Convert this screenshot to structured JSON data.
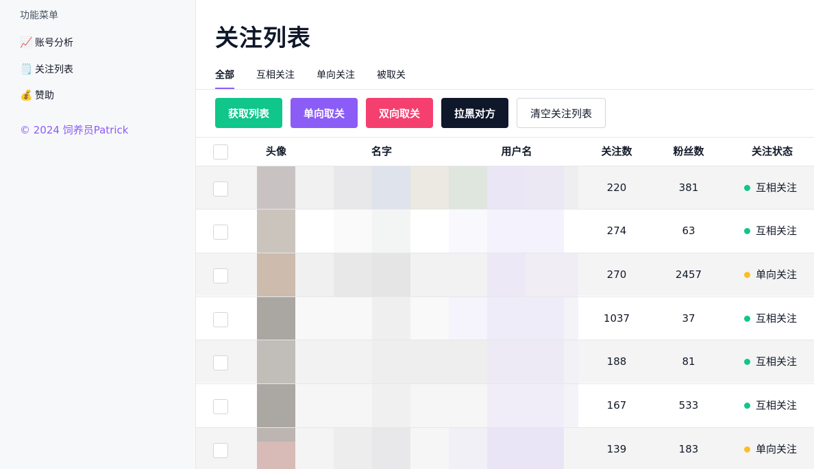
{
  "sidebar": {
    "heading": "功能菜单",
    "items": [
      {
        "icon": "📈",
        "icon_name": "chart-increasing-icon",
        "label": "账号分析"
      },
      {
        "icon": "🗒️",
        "icon_name": "notepad-icon",
        "label": "关注列表"
      },
      {
        "icon": "💰",
        "icon_name": "money-bag-icon",
        "label": "赞助"
      }
    ],
    "copyright": "© 2024 饲养员Patrick"
  },
  "main": {
    "title": "关注列表",
    "tabs": [
      {
        "label": "全部",
        "active": true
      },
      {
        "label": "互相关注",
        "active": false
      },
      {
        "label": "单向关注",
        "active": false
      },
      {
        "label": "被取关",
        "active": false
      }
    ],
    "buttons": {
      "fetch": "获取列表",
      "unfollow_oneway": "单向取关",
      "unfollow_twoway": "双向取关",
      "block": "拉黑对方",
      "clear": "清空关注列表"
    },
    "table": {
      "headers": {
        "avatar": "头像",
        "name": "名字",
        "username": "用户名",
        "following": "关注数",
        "followers": "粉丝数",
        "status": "关注状态"
      },
      "rows": [
        {
          "following": "220",
          "followers": "381",
          "status": "互相关注",
          "status_color": "#10c68a"
        },
        {
          "following": "274",
          "followers": "63",
          "status": "互相关注",
          "status_color": "#10c68a"
        },
        {
          "following": "270",
          "followers": "2457",
          "status": "单向关注",
          "status_color": "#fbbf24"
        },
        {
          "following": "1037",
          "followers": "37",
          "status": "互相关注",
          "status_color": "#10c68a"
        },
        {
          "following": "188",
          "followers": "81",
          "status": "互相关注",
          "status_color": "#10c68a"
        },
        {
          "following": "167",
          "followers": "533",
          "status": "互相关注",
          "status_color": "#10c68a"
        },
        {
          "following": "139",
          "followers": "183",
          "status": "单向关注",
          "status_color": "#fbbf24"
        }
      ]
    }
  },
  "colors": {
    "accent": "#8b5cf6",
    "success": "#10c68a",
    "danger": "#f43f6f",
    "dark": "#0f172a",
    "warning": "#fbbf24"
  }
}
